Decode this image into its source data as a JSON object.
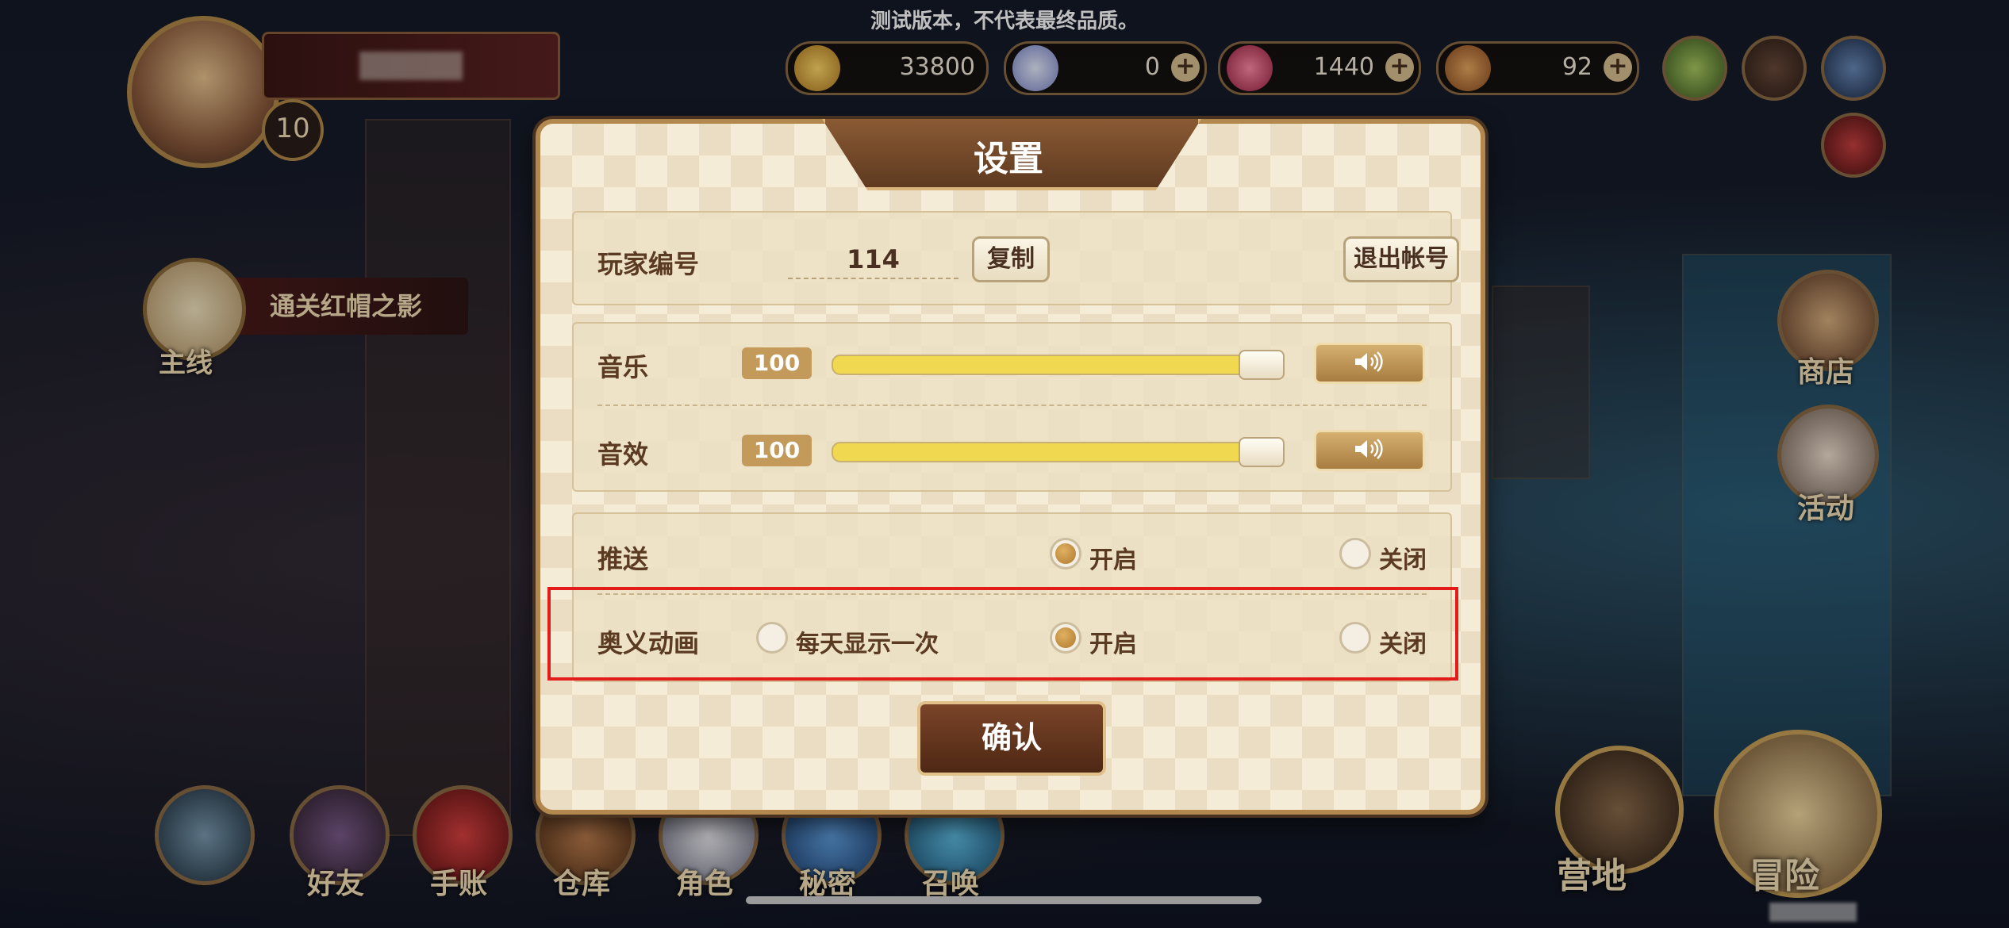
{
  "watermark": "测试版本，不代表最终品质。",
  "player": {
    "level": "10"
  },
  "quest": {
    "text": "通关红帽之影",
    "label": "主线"
  },
  "currencies": [
    {
      "icon": "gold-coin-icon",
      "value": "33800"
    },
    {
      "icon": "diamond-icon",
      "value": "0"
    },
    {
      "icon": "red-crystal-icon",
      "value": "1440"
    },
    {
      "icon": "bread-icon",
      "value": "92"
    }
  ],
  "side_menu": {
    "shop": "商店",
    "event": "活动"
  },
  "bottom_menu": [
    "好友",
    "手账",
    "仓库",
    "角色",
    "秘密",
    "召唤"
  ],
  "big_buttons": {
    "camp": "营地",
    "adventure": "冒险"
  },
  "dialog": {
    "title": "设置",
    "player_id_label": "玩家编号",
    "player_id": "114",
    "copy_label": "复制",
    "logout_label": "退出帐号",
    "music_label": "音乐",
    "music_value": "100",
    "music_level": 1.0,
    "sfx_label": "音效",
    "sfx_value": "100",
    "sfx_level": 1.0,
    "push_label": "推送",
    "push_on": "开启",
    "push_off": "关闭",
    "push_selected": "开启",
    "anim_label": "奥义动画",
    "anim_daily": "每天显示一次",
    "anim_on": "开启",
    "anim_off": "关闭",
    "anim_selected": "开启",
    "confirm_label": "确认"
  },
  "colors": {
    "accent": "#b2884e",
    "highlight": "#e31b1b",
    "slider": "#e8c84a"
  }
}
